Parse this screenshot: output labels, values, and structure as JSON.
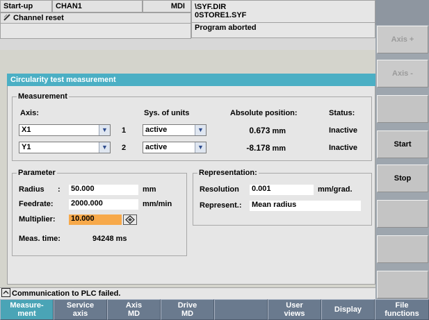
{
  "header": {
    "area": "Start-up",
    "channel": "CHAN1",
    "mode": "MDI",
    "program_path": "\\SYF.DIR",
    "program_name": "0STORE1.SYF",
    "channel_status": "Channel reset",
    "program_status": "Program aborted"
  },
  "window": {
    "title": "Circularity test measurement"
  },
  "measurement": {
    "legend": "Measurement",
    "col_axis": "Axis:",
    "col_units": "Sys. of units",
    "col_position": "Absolute position:",
    "col_status": "Status:",
    "rows": [
      {
        "axis": "X1",
        "index": "1",
        "units": "active",
        "position": "0.673",
        "unit": "mm",
        "status": "Inactive"
      },
      {
        "axis": "Y1",
        "index": "2",
        "units": "active",
        "position": "-8.178",
        "unit": "mm",
        "status": "Inactive"
      }
    ]
  },
  "parameter": {
    "legend": "Parameter",
    "radius_label": "Radius",
    "radius_colon": ":",
    "radius_value": "50.000",
    "radius_unit": "mm",
    "feedrate_label": "Feedrate:",
    "feedrate_value": "2000.000",
    "feedrate_unit": "mm/min",
    "multiplier_label": "Multiplier:",
    "multiplier_value": "10.000",
    "meas_time_label": "Meas. time:",
    "meas_time_value": "94248 ms"
  },
  "representation": {
    "legend": "Representation:",
    "resolution_label": "Resolution",
    "resolution_value": "0.001",
    "resolution_unit": "mm/grad.",
    "represent_label": "Represent.:",
    "represent_value": "Mean radius"
  },
  "alarm": {
    "message": "Communication to PLC failed."
  },
  "vertical_softkeys": [
    "Axis +",
    "Axis -",
    "",
    "Start",
    "Stop",
    "",
    "",
    ""
  ],
  "horizontal_softkeys": [
    {
      "line1": "Measure-",
      "line2": "ment"
    },
    {
      "line1": "Service",
      "line2": "axis"
    },
    {
      "line1": "Axis",
      "line2": "MD"
    },
    {
      "line1": "Drive",
      "line2": "MD"
    },
    {
      "line1": "",
      "line2": ""
    },
    {
      "line1": "User",
      "line2": "views"
    },
    {
      "line1": "Display",
      "line2": ""
    },
    {
      "line1": "File",
      "line2": "functions"
    }
  ],
  "icons": {
    "channel_reset": "pencil-strike-icon",
    "multiplier": "toggle-diamond-icon",
    "alarm": "alarm-caret-icon",
    "combo": "chevron-down-icon"
  },
  "colors": {
    "title_bar": "#4bafc4",
    "active_softkey": "#4aa4b6",
    "softkey_bar": "#6a7a8e",
    "highlight_field": "#f7a94a",
    "panel": "#d4d4cc"
  }
}
